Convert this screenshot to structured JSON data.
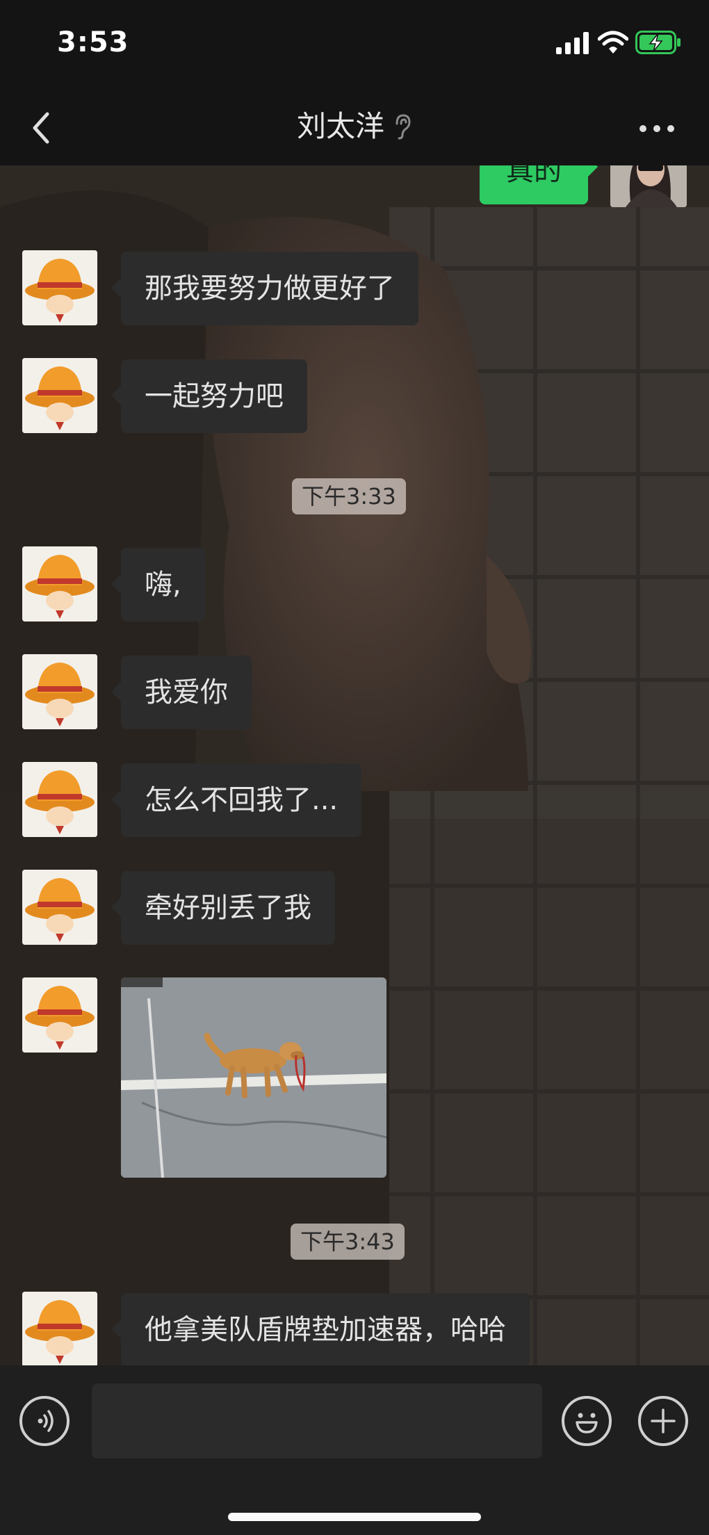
{
  "status": {
    "time": "3:53"
  },
  "header": {
    "title": "刘太洋"
  },
  "chat": {
    "sent_top": "真的",
    "messages": [
      "那我要努力做更好了",
      "一起努力吧",
      "嗨,",
      "我爱你",
      "怎么不回我了...",
      "牵好别丢了我",
      "他拿美队盾牌垫加速器，哈哈"
    ],
    "timestamps": [
      "下午3:33",
      "下午3:43"
    ]
  },
  "input": {
    "placeholder": ""
  },
  "colors": {
    "sent_bubble": "#2ecb63",
    "received_bubble": "#2c2c2c",
    "battery_charging": "#34c759"
  }
}
